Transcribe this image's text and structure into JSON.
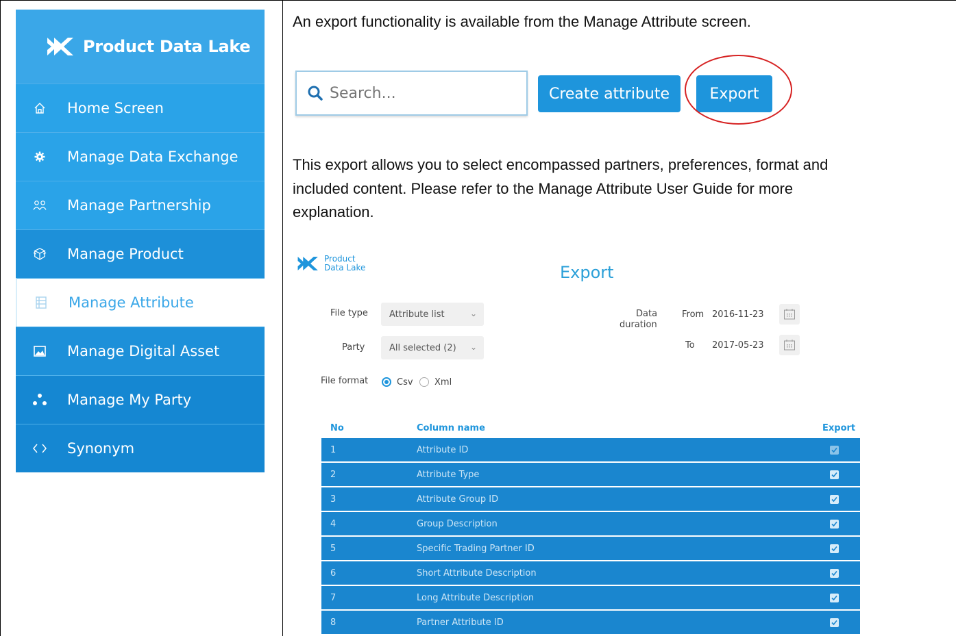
{
  "sidebar": {
    "logo_text": "Product Data Lake",
    "items": [
      {
        "label": "Home Screen",
        "icon": "home-icon"
      },
      {
        "label": "Manage Data Exchange",
        "icon": "gear-icon"
      },
      {
        "label": "Manage Partnership",
        "icon": "people-icon"
      },
      {
        "label": "Manage Product",
        "icon": "box-icon"
      },
      {
        "label": "Manage Attribute",
        "icon": "list-icon",
        "active": true
      },
      {
        "label": "Manage Digital Asset",
        "icon": "image-icon"
      },
      {
        "label": "Manage My Party",
        "icon": "network-icon"
      },
      {
        "label": "Synonym",
        "icon": "arrows-icon"
      }
    ]
  },
  "content": {
    "intro_text": "An export functionality is available from the Manage Attribute screen.",
    "search_placeholder": "Search...",
    "create_button": "Create attribute",
    "export_button": "Export",
    "desc_line1": "This export allows you to select encompassed partners, preferences, format and",
    "desc_line2": "included content. Please refer to the Manage Attribute User Guide for more",
    "desc_line3": "explanation."
  },
  "export_panel": {
    "logo_line1": "Product",
    "logo_line2": "Data Lake",
    "title": "Export",
    "file_type_label": "File type",
    "file_type_value": "Attribute list",
    "party_label": "Party",
    "party_value": "All selected (2)",
    "file_format_label": "File format",
    "format_csv": "Csv",
    "format_xml": "Xml",
    "data_label_1": "Data",
    "data_label_2": "duration",
    "from_label": "From",
    "from_value": "2016-11-23",
    "to_label": "To",
    "to_value": "2017-05-23",
    "table": {
      "col_no": "No",
      "col_name": "Column name",
      "col_export": "Export",
      "rows": [
        {
          "no": "1",
          "name": "Attribute ID"
        },
        {
          "no": "2",
          "name": "Attribute Type"
        },
        {
          "no": "3",
          "name": "Attribute Group ID"
        },
        {
          "no": "4",
          "name": "Group Description"
        },
        {
          "no": "5",
          "name": "Specific Trading Partner ID"
        },
        {
          "no": "6",
          "name": "Short Attribute Description"
        },
        {
          "no": "7",
          "name": "Long Attribute Description"
        },
        {
          "no": "8",
          "name": "Partner Attribute ID"
        }
      ]
    }
  },
  "colors": {
    "brand_blue": "#1e95dc",
    "highlight_red": "#d62222"
  }
}
